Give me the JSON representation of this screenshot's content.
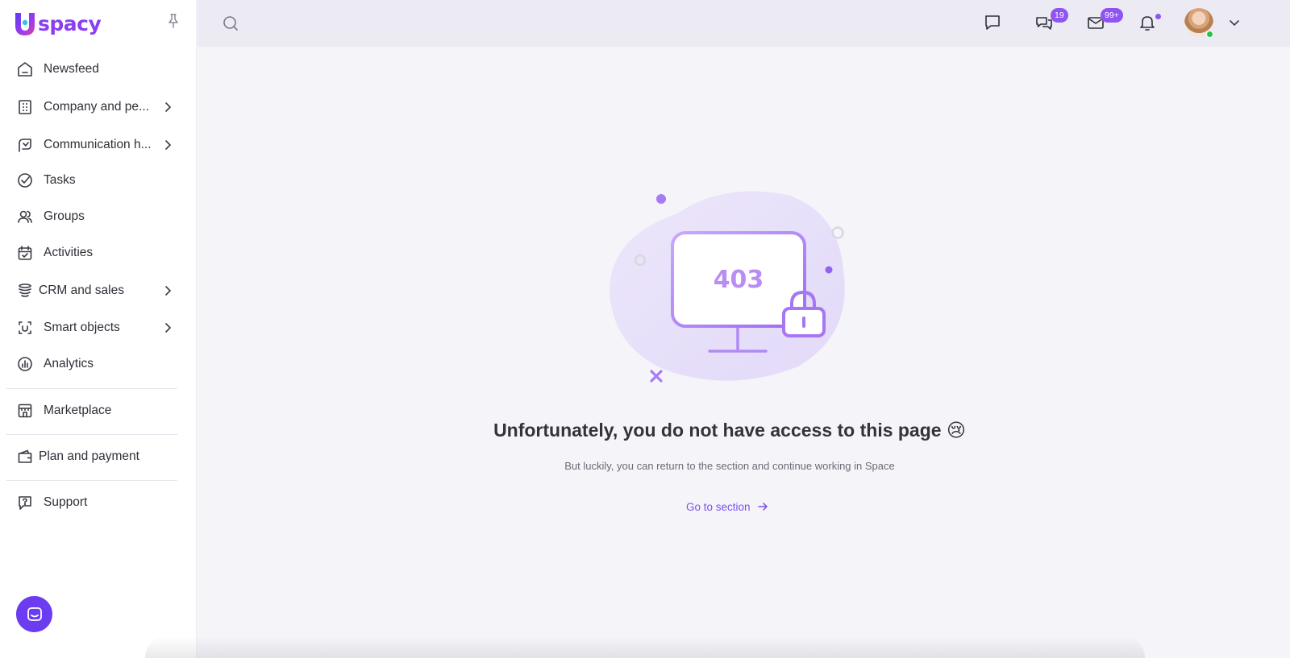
{
  "app": {
    "logo_text": "spacy",
    "brand_color": "#8a3ff0",
    "accent_color": "#7a4ef0"
  },
  "sidebar": {
    "items": [
      {
        "label": "Newsfeed",
        "icon": "home-icon",
        "has_submenu": false
      },
      {
        "label": "Company and pe...",
        "icon": "building-icon",
        "has_submenu": true
      },
      {
        "label": "Communication h...",
        "icon": "communication-icon",
        "has_submenu": true
      },
      {
        "label": "Tasks",
        "icon": "check-circle-icon",
        "has_submenu": false
      },
      {
        "label": "Groups",
        "icon": "users-icon",
        "has_submenu": false
      },
      {
        "label": "Activities",
        "icon": "calendar-check-icon",
        "has_submenu": false
      },
      {
        "label": "CRM and sales",
        "icon": "coins-stack-icon",
        "has_submenu": true
      },
      {
        "label": "Smart objects",
        "icon": "scan-face-icon",
        "has_submenu": true
      },
      {
        "label": "Analytics",
        "icon": "chart-circle-icon",
        "has_submenu": false
      },
      {
        "label": "Marketplace",
        "icon": "store-icon",
        "has_submenu": false
      },
      {
        "label": "Plan and payment",
        "icon": "wallet-icon",
        "has_submenu": false
      },
      {
        "label": "Support",
        "icon": "help-chat-icon",
        "has_submenu": false
      }
    ]
  },
  "topbar": {
    "chats_badge": "19",
    "mail_badge": "99+",
    "notifications_dot": true,
    "user_online": true
  },
  "error": {
    "code": "403",
    "title": "Unfortunately, you do not have access to this page 😢",
    "subtitle": "But luckily, you can return to the section and continue working in Space",
    "action_label": "Go to section"
  }
}
